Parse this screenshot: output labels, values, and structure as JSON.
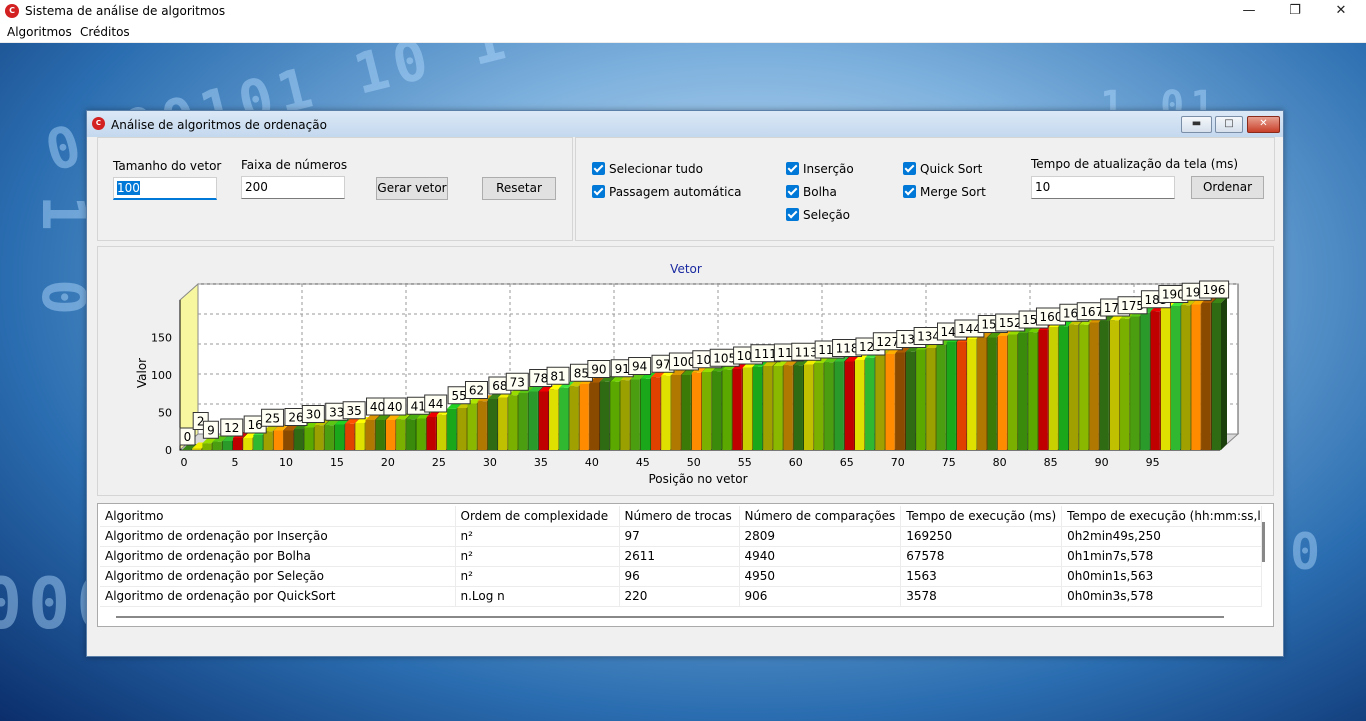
{
  "window": {
    "title": "Sistema de análise de algoritmos",
    "icon": "app-logo-icon",
    "controls": [
      "minimize-icon",
      "maximize-icon",
      "close-icon"
    ]
  },
  "menu": {
    "items": [
      "Algoritmos",
      "Créditos"
    ]
  },
  "child": {
    "title": "Análise de algoritmos de ordenação",
    "vector_panel": {
      "size_label": "Tamanho do vetor",
      "size_value": "100",
      "range_label": "Faixa de números",
      "range_value": "200",
      "generate_button": "Gerar vetor",
      "reset_button": "Resetar"
    },
    "options_panel": {
      "select_all": "Selecionar tudo",
      "auto_pass": "Passagem automática",
      "insertion": "Inserção",
      "bubble": "Bolha",
      "selection": "Seleção",
      "quick": "Quick Sort",
      "merge": "Merge Sort",
      "all_checked": true,
      "refresh_label": "Tempo de atualização da tela (ms)",
      "refresh_value": "10",
      "sort_button": "Ordenar"
    }
  },
  "chart_data": {
    "type": "bar",
    "title": "Vetor",
    "xlabel": "Posição no vetor",
    "ylabel": "Valor",
    "ylim": [
      0,
      200
    ],
    "yticks": [
      "0",
      "50",
      "100",
      "150"
    ],
    "xticks": [
      "0",
      "5",
      "10",
      "15",
      "20",
      "25",
      "30",
      "35",
      "40",
      "45",
      "50",
      "55",
      "60",
      "65",
      "70",
      "75",
      "80",
      "85",
      "90",
      "95"
    ],
    "grid": true,
    "style": "3d",
    "values": [
      0,
      2,
      9,
      11,
      12,
      16,
      16,
      20,
      25,
      26,
      26,
      28,
      30,
      33,
      33,
      34,
      35,
      36,
      40,
      40,
      40,
      41,
      41,
      42,
      44,
      47,
      55,
      56,
      62,
      65,
      68,
      70,
      73,
      76,
      78,
      78,
      81,
      83,
      85,
      88,
      90,
      91,
      91,
      93,
      94,
      95,
      97,
      99,
      100,
      100,
      103,
      104,
      105,
      107,
      108,
      110,
      111,
      112,
      112,
      113,
      113,
      114,
      116,
      117,
      118,
      118,
      120,
      123,
      127,
      128,
      130,
      131,
      134,
      136,
      140,
      144,
      144,
      148,
      150,
      150,
      152,
      154,
      156,
      157,
      160,
      164,
      165,
      167,
      167,
      170,
      172,
      173,
      175,
      178,
      183,
      185,
      190,
      192,
      193,
      194,
      196,
      196
    ],
    "bar_colors": [
      "#2f6b12",
      "#3a8a0c",
      "#4a9e10",
      "#c8d000",
      "#e0e000",
      "#8ab800",
      "#ff8c00",
      "#c0c000",
      "#5aa800",
      "#2a9a2a",
      "#1aa81a",
      "#30b830",
      "#b07800",
      "#8a4a00",
      "#7ab000",
      "#9aa000",
      "#c00000",
      "#e04000",
      "#a0a000",
      "#3c7a08"
    ]
  },
  "table": {
    "columns": [
      "Algoritmo",
      "Ordem de complexidade",
      "Número de trocas",
      "Número de comparações",
      "Tempo de execução (ms)",
      "Tempo de execução (hh:mm:ss,ll"
    ],
    "rows": [
      [
        "Algoritmo de ordenação por Inserção",
        "n²",
        "97",
        "2809",
        "169250",
        "0h2min49s,250"
      ],
      [
        "Algoritmo de ordenação por Bolha",
        "n²",
        "2611",
        "4940",
        "67578",
        "0h1min7s,578"
      ],
      [
        "Algoritmo de ordenação por Seleção",
        "n²",
        "96",
        "4950",
        "1563",
        "0h0min1s,563"
      ],
      [
        "Algoritmo de ordenação por QuickSort",
        "n.Log n",
        "220",
        "906",
        "3578",
        "0h0min3s,578"
      ]
    ]
  }
}
